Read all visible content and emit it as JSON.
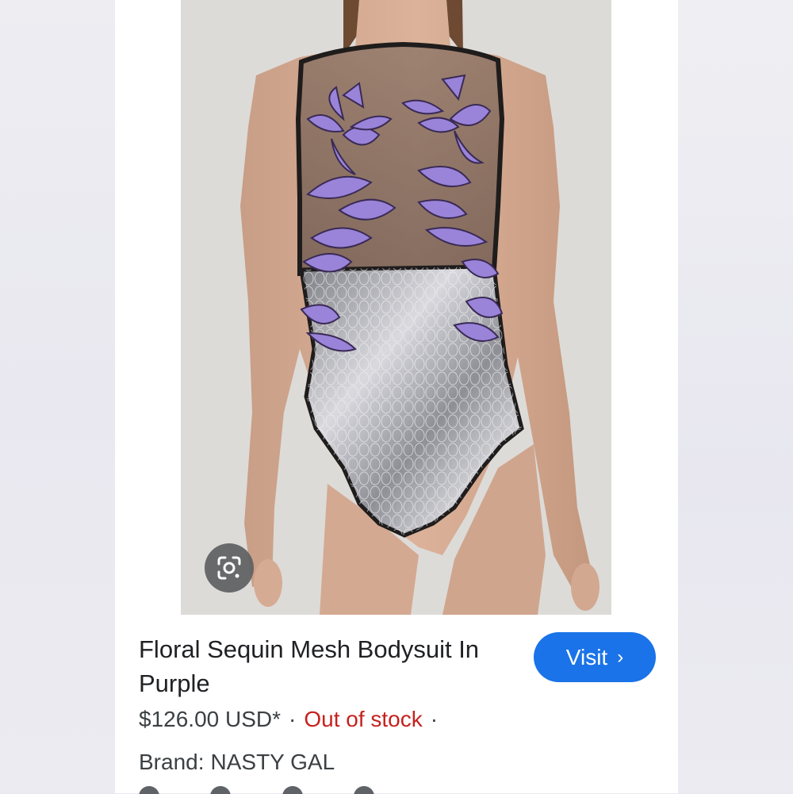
{
  "product": {
    "title": "Floral Sequin Mesh Bodysuit In Purple",
    "price": "$126.00 USD*",
    "separator": "·",
    "stock_status": "Out of stock",
    "brand_label": "Brand:",
    "brand_value": "NASTY GAL"
  },
  "actions": {
    "visit_label": "Visit",
    "visit_chevron": "›",
    "lens_icon": "google-lens-icon"
  },
  "colors": {
    "visit_button": "#1a73e8",
    "out_of_stock": "#c5221f",
    "sequin_purple": "#9a84d9",
    "sequin_silver": "#b9b9be"
  }
}
